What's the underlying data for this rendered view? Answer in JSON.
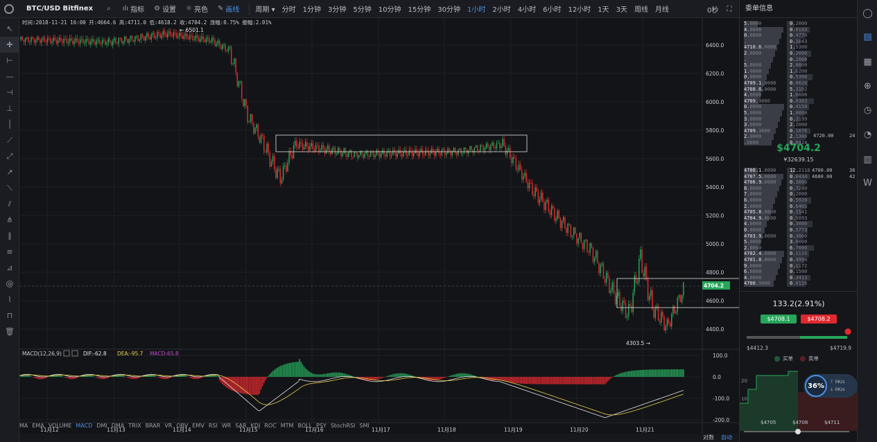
{
  "header": {
    "symbol": "BTC/USD Bitfinex",
    "tools": [
      {
        "label": "指标",
        "icon": "indicator-icon"
      },
      {
        "label": "设置",
        "icon": "gear-icon"
      },
      {
        "label": "亮色",
        "icon": "sun-icon"
      },
      {
        "label": "画线",
        "icon": "pen-icon",
        "active": true
      }
    ],
    "period_label": "周期",
    "periods": [
      "分时",
      "1分钟",
      "3分钟",
      "5分钟",
      "10分钟",
      "15分钟",
      "30分钟",
      "1小时",
      "2小时",
      "4小时",
      "6小时",
      "12小时",
      "1天",
      "3天",
      "周线",
      "月线"
    ],
    "active_period": "1小时",
    "countdown": "0秒"
  },
  "info_line": "时间:2018-11-21 16:00  开:4664.6  高:4711.0  低:4618.2  收:4704.2  涨幅:0.75%  振幅:2.01%",
  "price_axis": [
    "6400.0",
    "6200.0",
    "6000.0",
    "5800.0",
    "5600.0",
    "5400.0",
    "5200.0",
    "5000.0",
    "4800.0",
    "4600.0",
    "4400.0"
  ],
  "current_price_tag": "4704.2",
  "high_marker": "6501.1",
  "low_marker": "4303.5",
  "macd": {
    "title": "MACD(12,26,9)",
    "dif": "DIF:-62.8",
    "dea": "DEA:-95.7",
    "macd": "MACD:65.8",
    "axis": [
      "100.0",
      "0.0",
      "-100.0",
      "-200.0"
    ]
  },
  "indicators": [
    "MA",
    "EMA",
    "VOLUME",
    "MACD",
    "DMI",
    "DMA",
    "TRIX",
    "BRAR",
    "VR",
    "OBV",
    "EMV",
    "RSI",
    "WR",
    "SAR",
    "KDJ",
    "ROC",
    "MTM",
    "BOLL",
    "PSY",
    "StochRSI",
    "SMI"
  ],
  "active_indicator": "MACD",
  "x_axis": [
    "11月12",
    "11月13",
    "11月14",
    "11月15",
    "11月16",
    "11月17",
    "11月18",
    "11月19",
    "11月20",
    "11月21"
  ],
  "bottom_right": {
    "log": "对数",
    "auto": "自动"
  },
  "orderbook": {
    "title": "委单信息",
    "asks": [
      [
        "5",
        "0000",
        "0",
        "2000"
      ],
      [
        "4",
        "0000",
        "0",
        "0183"
      ],
      [
        "0",
        "0000",
        "0",
        "4770"
      ],
      [
        "",
        "",
        "0",
        "1043"
      ],
      [
        "4710.6",
        "0000",
        "1",
        "5300"
      ],
      [
        "2",
        "0000",
        "0",
        "2000"
      ],
      [
        "",
        "",
        "0",
        "2000"
      ],
      [
        "5",
        "0000",
        "2",
        "0000"
      ],
      [
        "1",
        "0000",
        "1",
        "6200"
      ],
      [
        "0",
        "0000",
        "0",
        "5300"
      ],
      [
        "4709.1",
        "0000",
        "0",
        "0620"
      ],
      [
        "4708.6",
        "0000",
        "5",
        "3192"
      ],
      [
        "4",
        "0000",
        "1",
        "0600"
      ],
      [
        "4709",
        "9000",
        "0",
        "0303"
      ],
      [
        "0",
        "0000",
        "0",
        "4150"
      ],
      [
        "5",
        "0000",
        "1",
        "0000"
      ],
      [
        "3",
        "0000",
        "0",
        "2199"
      ],
      [
        "3",
        "0000",
        "2",
        "2000"
      ],
      [
        "4709",
        "3000",
        "0",
        "1076"
      ],
      [
        "2",
        "0000",
        "2",
        "1300"
      ],
      [
        "",
        "0000",
        "0",
        "0424"
      ]
    ],
    "right_ask": {
      "price": "4720.00",
      "amount": "24"
    },
    "last_price": "$4704.2",
    "last_cny": "¥32639.15",
    "bids": [
      [
        "4708.1",
        "0000",
        "12",
        "2118"
      ],
      [
        "4707.5",
        "0000",
        "0",
        "0434"
      ],
      [
        "4706.9",
        "0000",
        "0",
        "3000"
      ],
      [
        "8",
        "0000",
        "0",
        "7280"
      ],
      [
        "7",
        "0000",
        "0",
        "2000"
      ],
      [
        "6",
        "0000",
        "0",
        "5920"
      ],
      [
        "2",
        "0000",
        "0",
        "6403"
      ],
      [
        "4705.8",
        "0000",
        "0",
        "1541"
      ],
      [
        "4704.9",
        "0000",
        "0",
        "5093"
      ],
      [
        "4",
        "0000",
        "0",
        "3000"
      ],
      [
        "0",
        "0000",
        "0",
        "5773"
      ],
      [
        "4703.9",
        "0000",
        "0",
        "3000"
      ],
      [
        "5",
        "0000",
        "3",
        "0000"
      ],
      [
        "2",
        "0000",
        "6",
        "7000"
      ],
      [
        "4702.4",
        "0000",
        "0",
        "1115"
      ],
      [
        "4701.8",
        "0000",
        "0",
        "4990"
      ],
      [
        "9",
        "0000",
        "0",
        "1172"
      ],
      [
        "6",
        "0000",
        "0",
        "1500"
      ],
      [
        "4",
        "0000",
        "0",
        "3413"
      ],
      [
        "4700",
        "9000",
        "0",
        "0126"
      ]
    ],
    "right_bids": [
      {
        "price": "4700.00",
        "amount": "36"
      },
      {
        "price": "4680.00",
        "amount": "42"
      }
    ],
    "change": "133.2(2.91%)",
    "buy_price": "$4708.1",
    "sell_price": "$4708.2",
    "range_low": "$4412.3",
    "range_high": "$4719.9",
    "legend_buy": "买单",
    "legend_sell": "卖单",
    "depth_axis_y": [
      "20",
      "10"
    ],
    "depth_axis_x": [
      "$4705",
      "$4708",
      "$4711"
    ],
    "net_percent": "36%",
    "net_up": "0K/s",
    "net_down": "0K/s"
  },
  "colors": {
    "up": "#26a65b",
    "down": "#e0292e",
    "accent": "#4a8fe7"
  }
}
